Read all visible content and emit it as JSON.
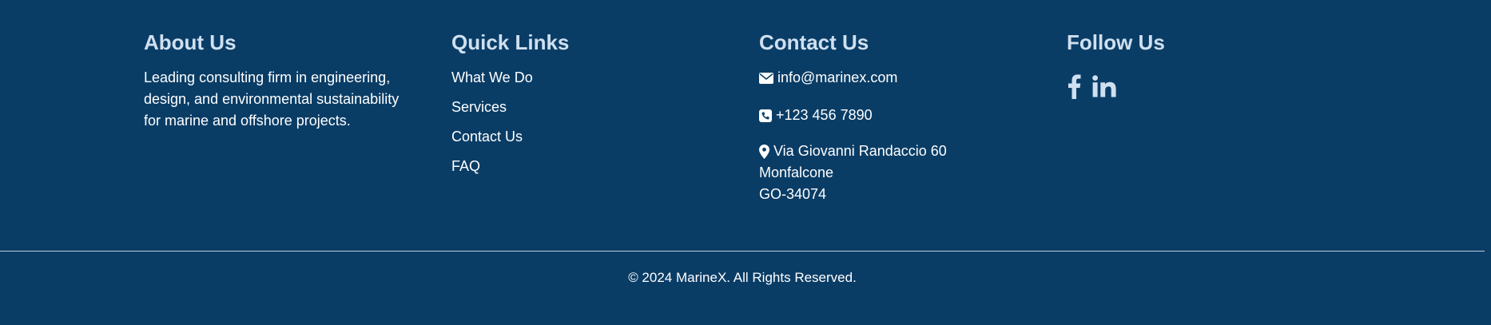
{
  "colors": {
    "background": "#0a3d66",
    "heading": "#cfe0f0",
    "text": "#ffffff",
    "divider": "#b9cbdc"
  },
  "about": {
    "heading": "About Us",
    "text_line1": "Leading consulting firm in engineering,",
    "text_line2": "design, and environmental sustainability",
    "text_line3": "for marine and offshore projects."
  },
  "quick_links": {
    "heading": "Quick Links",
    "items": [
      {
        "label": "What We Do"
      },
      {
        "label": "Services"
      },
      {
        "label": "Contact Us"
      },
      {
        "label": "FAQ"
      }
    ]
  },
  "contact": {
    "heading": "Contact Us",
    "email": "info@marinex.com",
    "email_icon": "envelope-icon",
    "phone": "+123 456 7890",
    "phone_icon": "phone-square-icon",
    "address_icon": "map-pin-icon",
    "address_line1": "Via Giovanni Randaccio 60",
    "address_line2": "Monfalcone",
    "address_line3": "GO-34074"
  },
  "follow": {
    "heading": "Follow Us",
    "icons": [
      "facebook-icon",
      "linkedin-icon"
    ]
  },
  "footer": {
    "copyright": "© 2024 MarineX. All Rights Reserved."
  }
}
